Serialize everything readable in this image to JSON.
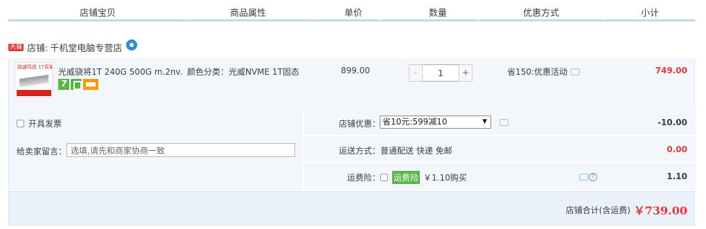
{
  "columns": [
    "店铺宝贝",
    "商品属性",
    "单价",
    "数量",
    "优惠方式",
    "小计"
  ],
  "shop": {
    "badge": "天猫",
    "label": "店铺:",
    "name": "千机堂电脑专营店",
    "thumb_text": "骁速鸣盘 1T容量"
  },
  "item": {
    "title": "光威骁将1T 240G 500G m.2nv...",
    "attribute": "颜色分类：光威NVME 1T固态",
    "price": "899.00",
    "quantity": "1",
    "minus": "-",
    "plus": "+",
    "promotion": "省150:优惠活动",
    "subtotal": "749.00"
  },
  "options": {
    "invoice_label": "开具发票",
    "message_label": "给卖家留言：",
    "message_placeholder": "选填,请先和商家协商一致",
    "shop_discount_label": "店铺优惠：",
    "shop_discount_selected": "省10元:599减10",
    "shop_discount_value": "-10.00",
    "shipping_label": "运送方式：",
    "shipping_value": "普通配送 快递 免邮",
    "shipping_cost": "0.00",
    "insurance_label": "运费险：",
    "insurance_tag": "运费险",
    "insurance_text": "￥1.10购买",
    "insurance_value": "1.10"
  },
  "total": {
    "label": "店铺合计(含运费)",
    "value": "￥739.00"
  },
  "colors": {
    "accent_red": "#e4393c",
    "header_border": "#c2d7e8",
    "row_bg": "#f3f7fc",
    "green_tag": "#5bb548"
  }
}
